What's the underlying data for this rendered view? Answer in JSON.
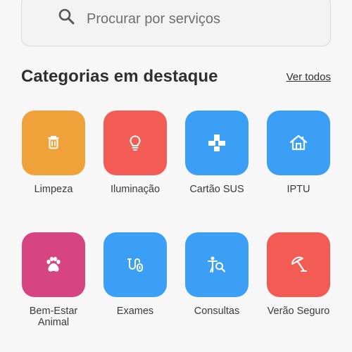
{
  "search": {
    "placeholder": "Procurar por serviços"
  },
  "section": {
    "title": "Categorias em destaque",
    "see_all": "Ver todos"
  },
  "categories": [
    {
      "label": "Limpeza",
      "color": "#f0a23a",
      "icon": "trash-icon"
    },
    {
      "label": "Iluminação",
      "color": "#f25c54",
      "icon": "lightbulb-icon"
    },
    {
      "label": "Cartão SUS",
      "color": "#3ba0f5",
      "icon": "health-card-icon"
    },
    {
      "label": "IPTU",
      "color": "#3ba0f5",
      "icon": "house-icon"
    },
    {
      "label": "Bem-Estar Animal",
      "color": "#d6457f",
      "icon": "paw-icon"
    },
    {
      "label": "Exames",
      "color": "#3ba0f5",
      "icon": "test-tube-icon"
    },
    {
      "label": "Consultas",
      "color": "#3ba0f5",
      "icon": "doctor-search-icon"
    },
    {
      "label": "Verão Seguro",
      "color": "#f25c54",
      "icon": "umbrella-icon"
    }
  ]
}
